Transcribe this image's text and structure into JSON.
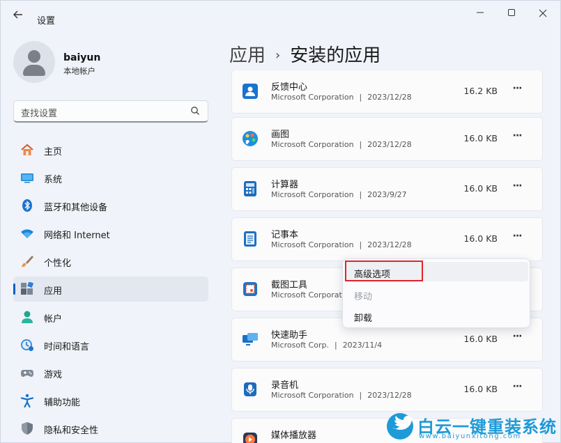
{
  "window": {
    "title": "设置",
    "controls": [
      "minimize",
      "maximize",
      "close"
    ]
  },
  "user": {
    "name": "baiyun",
    "account_type": "本地帐户"
  },
  "search": {
    "placeholder": "查找设置"
  },
  "sidebar": {
    "active": "应用",
    "items": [
      {
        "label": "主页",
        "icon": "home-icon"
      },
      {
        "label": "系统",
        "icon": "system-icon"
      },
      {
        "label": "蓝牙和其他设备",
        "icon": "bluetooth-icon"
      },
      {
        "label": "网络和 Internet",
        "icon": "wifi-icon"
      },
      {
        "label": "个性化",
        "icon": "brush-icon"
      },
      {
        "label": "应用",
        "icon": "apps-icon"
      },
      {
        "label": "帐户",
        "icon": "account-icon"
      },
      {
        "label": "时间和语言",
        "icon": "clock-globe-icon"
      },
      {
        "label": "游戏",
        "icon": "gamepad-icon"
      },
      {
        "label": "辅助功能",
        "icon": "accessibility-icon"
      },
      {
        "label": "隐私和安全性",
        "icon": "shield-icon"
      }
    ]
  },
  "breadcrumb": {
    "parent": "应用",
    "separator": "›",
    "current": "安装的应用"
  },
  "apps": [
    {
      "name": "反馈中心",
      "publisher": "Microsoft Corporation",
      "date": "2023/12/28",
      "size": "16.2 KB",
      "icon": "feedback-hub-icon"
    },
    {
      "name": "画图",
      "publisher": "Microsoft Corporation",
      "date": "2023/12/28",
      "size": "16.0 KB",
      "icon": "paint-icon"
    },
    {
      "name": "计算器",
      "publisher": "Microsoft Corporation",
      "date": "2023/9/27",
      "size": "16.0 KB",
      "icon": "calculator-icon"
    },
    {
      "name": "记事本",
      "publisher": "Microsoft Corporation",
      "date": "2023/12/28",
      "size": "16.0 KB",
      "icon": "notepad-icon"
    },
    {
      "name": "截图工具",
      "publisher": "Microsoft Corporati",
      "date": "",
      "size": "",
      "icon": "snipping-tool-icon"
    },
    {
      "name": "快速助手",
      "publisher": "Microsoft Corp.",
      "date": "2023/11/4",
      "size": "16.0 KB",
      "icon": "quick-assist-icon"
    },
    {
      "name": "录音机",
      "publisher": "Microsoft Corporation",
      "date": "2023/12/28",
      "size": "16.0 KB",
      "icon": "voice-recorder-icon"
    },
    {
      "name": "媒体播放器",
      "publisher": "",
      "date": "",
      "size": "",
      "icon": "media-player-icon"
    }
  ],
  "meta_separator": "|",
  "more_label": "···",
  "context_menu": {
    "items": [
      {
        "label": "高级选项",
        "enabled": true
      },
      {
        "label": "移动",
        "enabled": false
      },
      {
        "label": "卸载",
        "enabled": true
      }
    ]
  },
  "watermark": {
    "text": "白云一键重装系统",
    "url": "www.baiyunxitong.com"
  },
  "colors": {
    "accent": "#0a5fc2",
    "highlight_box": "#e0232b",
    "watermark": "#1e9ad8"
  }
}
